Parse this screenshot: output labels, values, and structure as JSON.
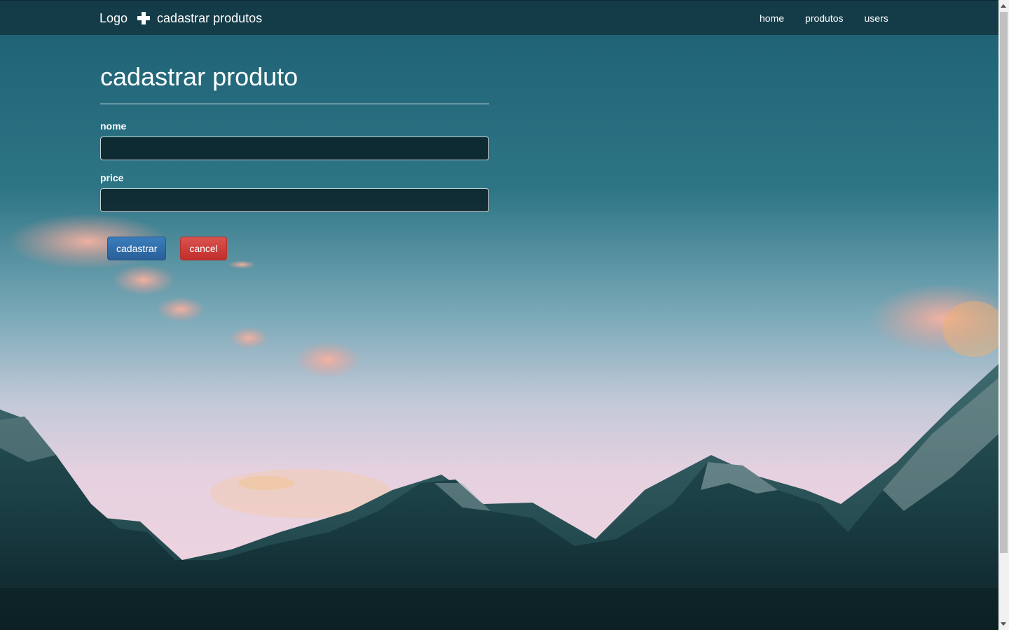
{
  "navbar": {
    "logo": "Logo",
    "brand_icon": "plus-icon",
    "title": "cadastrar produtos",
    "links": [
      "home",
      "produtos",
      "users"
    ]
  },
  "form": {
    "heading": "cadastrar produto",
    "fields": [
      {
        "label": "nome",
        "value": "",
        "placeholder": ""
      },
      {
        "label": "price",
        "value": "",
        "placeholder": ""
      }
    ],
    "submit_label": "cadastrar",
    "cancel_label": "cancel"
  },
  "colors": {
    "navbar_bg": "#12343e",
    "primary_button": "#337ab7",
    "danger_button": "#d9534f",
    "sky_top": "#1f6479",
    "sky_horizon": "#e6cedd",
    "mountains": "#163c44"
  }
}
